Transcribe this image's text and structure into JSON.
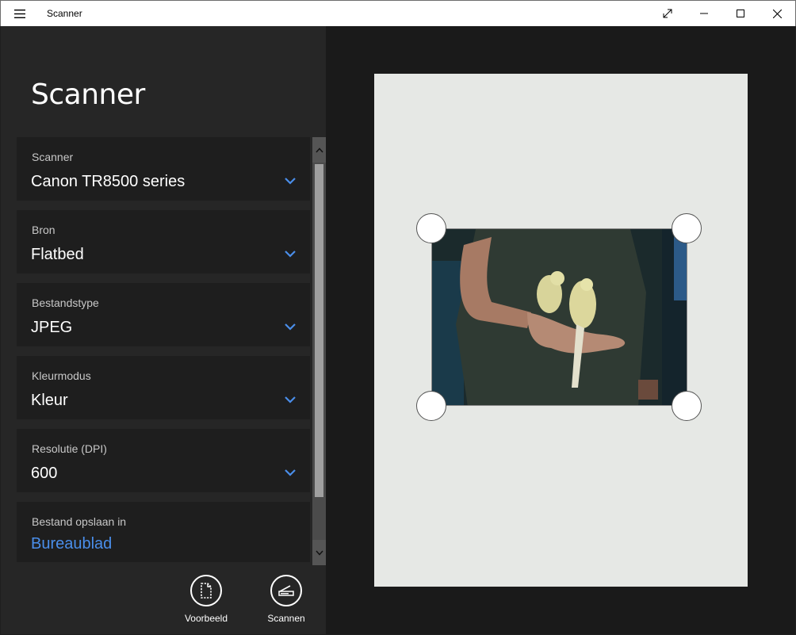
{
  "window": {
    "title": "Scanner",
    "menu_icon": "hamburger-menu-icon",
    "controls": [
      "fullscreen-icon",
      "minimize-icon",
      "maximize-icon",
      "close-icon"
    ]
  },
  "page": {
    "title": "Scanner"
  },
  "settings": [
    {
      "label": "Scanner",
      "value": "Canon TR8500 series"
    },
    {
      "label": "Bron",
      "value": "Flatbed"
    },
    {
      "label": "Bestandstype",
      "value": "JPEG"
    },
    {
      "label": "Kleurmodus",
      "value": "Kleur"
    },
    {
      "label": "Resolutie (DPI)",
      "value": "600"
    }
  ],
  "save_location": {
    "label": "Bestand opslaan in",
    "value": "Bureaublad"
  },
  "actions": {
    "preview_label": "Voorbeeld",
    "scan_label": "Scannen"
  },
  "colors": {
    "accent": "#4a8eea",
    "pane_background": "#262626",
    "card_background": "#1e1e1e",
    "preview_background": "#1a1a1a",
    "scan_page": "#e6e8e5"
  }
}
